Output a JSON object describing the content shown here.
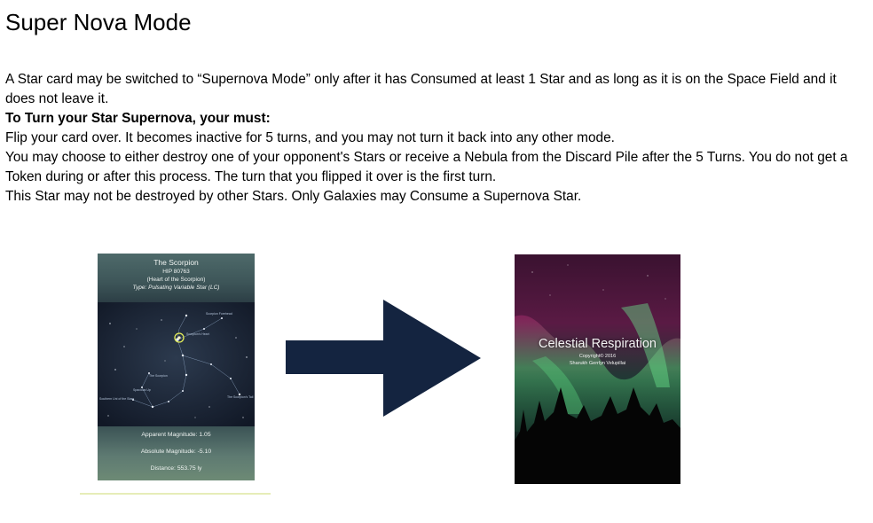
{
  "page": {
    "title": "Super Nova Mode",
    "paragraphs": {
      "intro": "A Star card may be switched to “Supernova Mode” only after it has Consumed at least 1 Star and as long as it is on the Space Field and it does not leave it.",
      "heading": "To Turn your Star Supernova, your must:",
      "step1": "Flip your card over. It becomes inactive for 5 turns, and you may not turn it back into any other mode.",
      "step2": "You may choose to either destroy one of your opponent's Stars or receive a Nebula from the Discard Pile after the 5 Turns. You do not get a Token during or after this process. The turn that you flipped it over is the first turn.",
      "step3": "This Star may not be destroyed by other Stars. Only Galaxies may Consume a Supernova Star."
    }
  },
  "star_card": {
    "name": "The Scorpion",
    "hip": "HIP 80763",
    "nickname": "(Heart of the Scorpion)",
    "type": "Type: Pulsating Variable Star (LC)",
    "map_labels": {
      "top_right": "Scorpion Forehead",
      "marker": "Scorpion's Heart",
      "mid": "The Scorpion",
      "left_low": "Spacious Up",
      "left_bottom": "Southern Uni of the Stars",
      "right_bottom": "The Scorpion's Tail"
    },
    "apparent_magnitude": "Apparent Magnitude: 1.05",
    "absolute_magnitude": "Absolute Magnitude: -5.10",
    "distance": "Distance: 553.75 ly"
  },
  "arrow": {
    "color": "#142440",
    "icon": "arrow-right-icon"
  },
  "back_card": {
    "title": "Celestial Respiration",
    "copyright": "Copyright© 2016",
    "author": "Sharukh Gerrlyn Velupillai"
  },
  "colors": {
    "arrow": "#142440",
    "card_border_underline": "#e6edb8"
  }
}
